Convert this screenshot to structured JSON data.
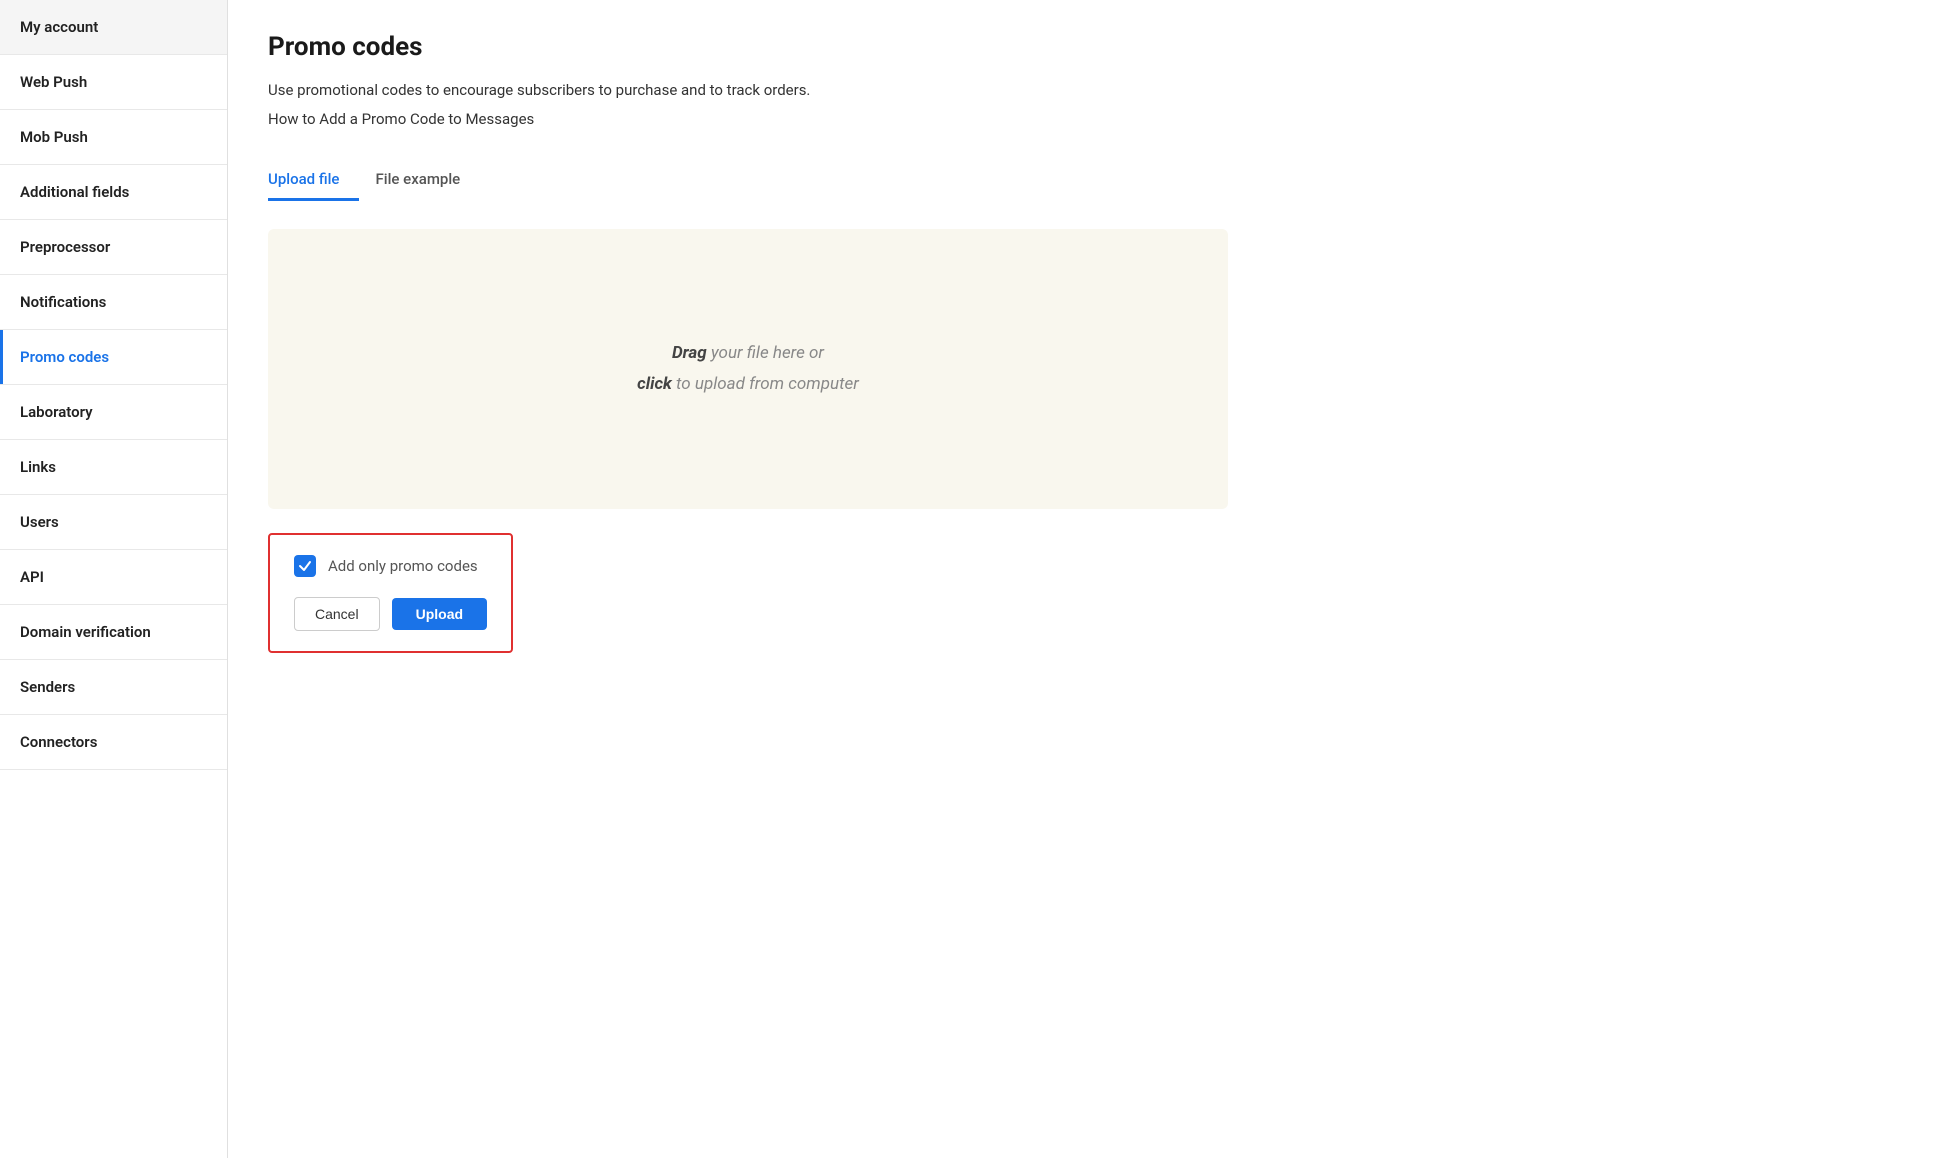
{
  "sidebar": {
    "items": [
      {
        "id": "my-account",
        "label": "My account",
        "active": false
      },
      {
        "id": "web-push",
        "label": "Web Push",
        "active": false
      },
      {
        "id": "mob-push",
        "label": "Mob Push",
        "active": false
      },
      {
        "id": "additional-fields",
        "label": "Additional fields",
        "active": false
      },
      {
        "id": "preprocessor",
        "label": "Preprocessor",
        "active": false
      },
      {
        "id": "notifications",
        "label": "Notifications",
        "active": false
      },
      {
        "id": "promo-codes",
        "label": "Promo codes",
        "active": true
      },
      {
        "id": "laboratory",
        "label": "Laboratory",
        "active": false
      },
      {
        "id": "links",
        "label": "Links",
        "active": false
      },
      {
        "id": "users",
        "label": "Users",
        "active": false
      },
      {
        "id": "api",
        "label": "API",
        "active": false
      },
      {
        "id": "domain-verification",
        "label": "Domain verification",
        "active": false
      },
      {
        "id": "senders",
        "label": "Senders",
        "active": false
      },
      {
        "id": "connectors",
        "label": "Connectors",
        "active": false
      }
    ]
  },
  "main": {
    "title": "Promo codes",
    "description": "Use promotional codes to encourage subscribers to purchase and to track orders.",
    "link_text": "How to Add a Promo Code to Messages",
    "tabs": [
      {
        "id": "upload-file",
        "label": "Upload file",
        "active": true
      },
      {
        "id": "file-example",
        "label": "File example",
        "active": false
      }
    ],
    "dropzone": {
      "line1_bold": "Drag",
      "line1_rest": " your file here or",
      "line2_bold": "click",
      "line2_rest": " to upload from computer"
    },
    "action_area": {
      "checkbox_label": "Add only promo codes",
      "checkbox_checked": true,
      "cancel_label": "Cancel",
      "upload_label": "Upload"
    }
  },
  "colors": {
    "active_blue": "#1a73e8",
    "border_red": "#e03030"
  }
}
